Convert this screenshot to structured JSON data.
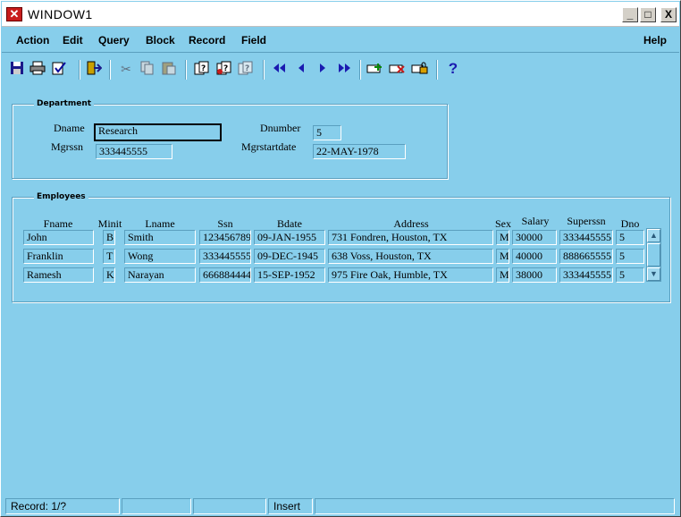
{
  "window": {
    "title": "WINDOW1",
    "minimize": "_",
    "maximize": "□",
    "close": "X"
  },
  "menu": {
    "items": [
      "Action",
      "Edit",
      "Query",
      "Block",
      "Record",
      "Field"
    ],
    "help": "Help"
  },
  "toolbar": {
    "icons": [
      "save-icon",
      "print-icon",
      "clear-form-icon",
      "exit-icon",
      "cut-icon",
      "copy-icon",
      "paste-icon",
      "enter-query-icon",
      "execute-query-icon",
      "count-query-icon",
      "first-record-icon",
      "previous-record-icon",
      "next-record-icon",
      "last-record-icon",
      "insert-record-icon",
      "delete-record-icon",
      "lock-record-icon",
      "help-icon"
    ]
  },
  "department": {
    "frame_title": "Department",
    "dname_label": "Dname",
    "dname_value": "Research",
    "dnumber_label": "Dnumber",
    "dnumber_value": "5",
    "mgrssn_label": "Mgrssn",
    "mgrssn_value": "333445555",
    "mgrstartdate_label": "Mgrstartdate",
    "mgrstartdate_value": "22-MAY-1978"
  },
  "employees": {
    "frame_title": "Employees",
    "headers": {
      "fname": "Fname",
      "minit": "Minit",
      "lname": "Lname",
      "ssn": "Ssn",
      "bdate": "Bdate",
      "address": "Address",
      "sex": "Sex",
      "salary": "Salary",
      "superssn": "Superssn",
      "dno": "Dno"
    },
    "rows": [
      {
        "fname": "John",
        "minit": "B",
        "lname": "Smith",
        "ssn": "123456789",
        "bdate": "09-JAN-1955",
        "address": "731 Fondren, Houston, TX",
        "sex": "M",
        "salary": "30000",
        "superssn": "333445555",
        "dno": "5"
      },
      {
        "fname": "Franklin",
        "minit": "T",
        "lname": "Wong",
        "ssn": "333445555",
        "bdate": "09-DEC-1945",
        "address": "638 Voss, Houston, TX",
        "sex": "M",
        "salary": "40000",
        "superssn": "888665555",
        "dno": "5"
      },
      {
        "fname": "Ramesh",
        "minit": "K",
        "lname": "Narayan",
        "ssn": "666884444",
        "bdate": "15-SEP-1952",
        "address": "975 Fire Oak, Humble, TX",
        "sex": "M",
        "salary": "38000",
        "superssn": "333445555",
        "dno": "5"
      }
    ]
  },
  "status": {
    "record": "Record: 1/?",
    "mode": "Insert"
  },
  "colors": {
    "background": "#87ceeb",
    "title_icon": "#c81c1c"
  }
}
